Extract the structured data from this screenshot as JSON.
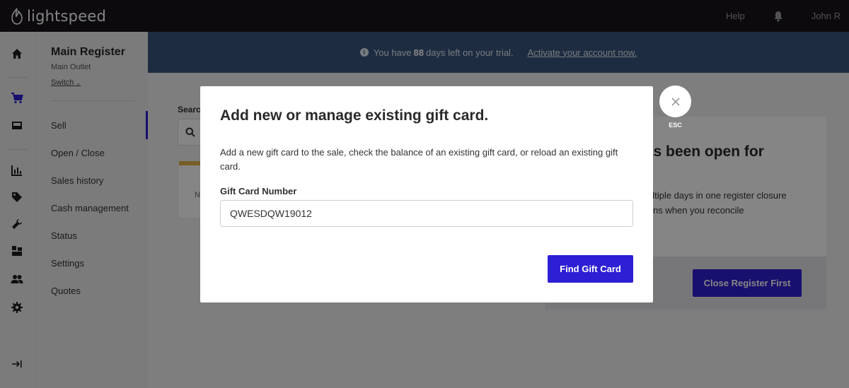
{
  "brand": {
    "name": "lightspeed"
  },
  "topbar": {
    "help": "Help",
    "user": "John R"
  },
  "rail": {
    "icons": [
      "home-icon",
      "cart-icon",
      "register-icon",
      "chart-icon",
      "tag-icon",
      "wrench-icon",
      "inventory-icon",
      "users-icon",
      "gear-icon",
      "collapse-icon"
    ]
  },
  "menu": {
    "register_name": "Main Register",
    "outlet": "Main Outlet",
    "switch": "Switch",
    "items": [
      "Sell",
      "Open / Close",
      "Sales history",
      "Cash management",
      "Status",
      "Settings",
      "Quotes"
    ],
    "active": "Sell"
  },
  "banner": {
    "prefix": "You have",
    "days": "88",
    "suffix": "days left on your trial.",
    "link": "Activate your account now."
  },
  "background": {
    "search_label": "Searc",
    "card_text": "N",
    "panel_heading": "has been open for",
    "panel_line1": "ultiple days in one register closure",
    "panel_line2": "ns when you reconcile",
    "close_register_button": "Close Register First"
  },
  "modal": {
    "title": "Add new or manage existing gift card.",
    "description": "Add a new gift card to the sale, check the balance of an existing gift card, or reload an existing gift card.",
    "field_label": "Gift Card Number",
    "field_value": "QWESDQW19012",
    "find_button": "Find Gift Card",
    "esc_label": "ESC"
  },
  "colors": {
    "accent": "#2d1fd4",
    "banner": "#3a557d",
    "topbar": "#171519"
  }
}
